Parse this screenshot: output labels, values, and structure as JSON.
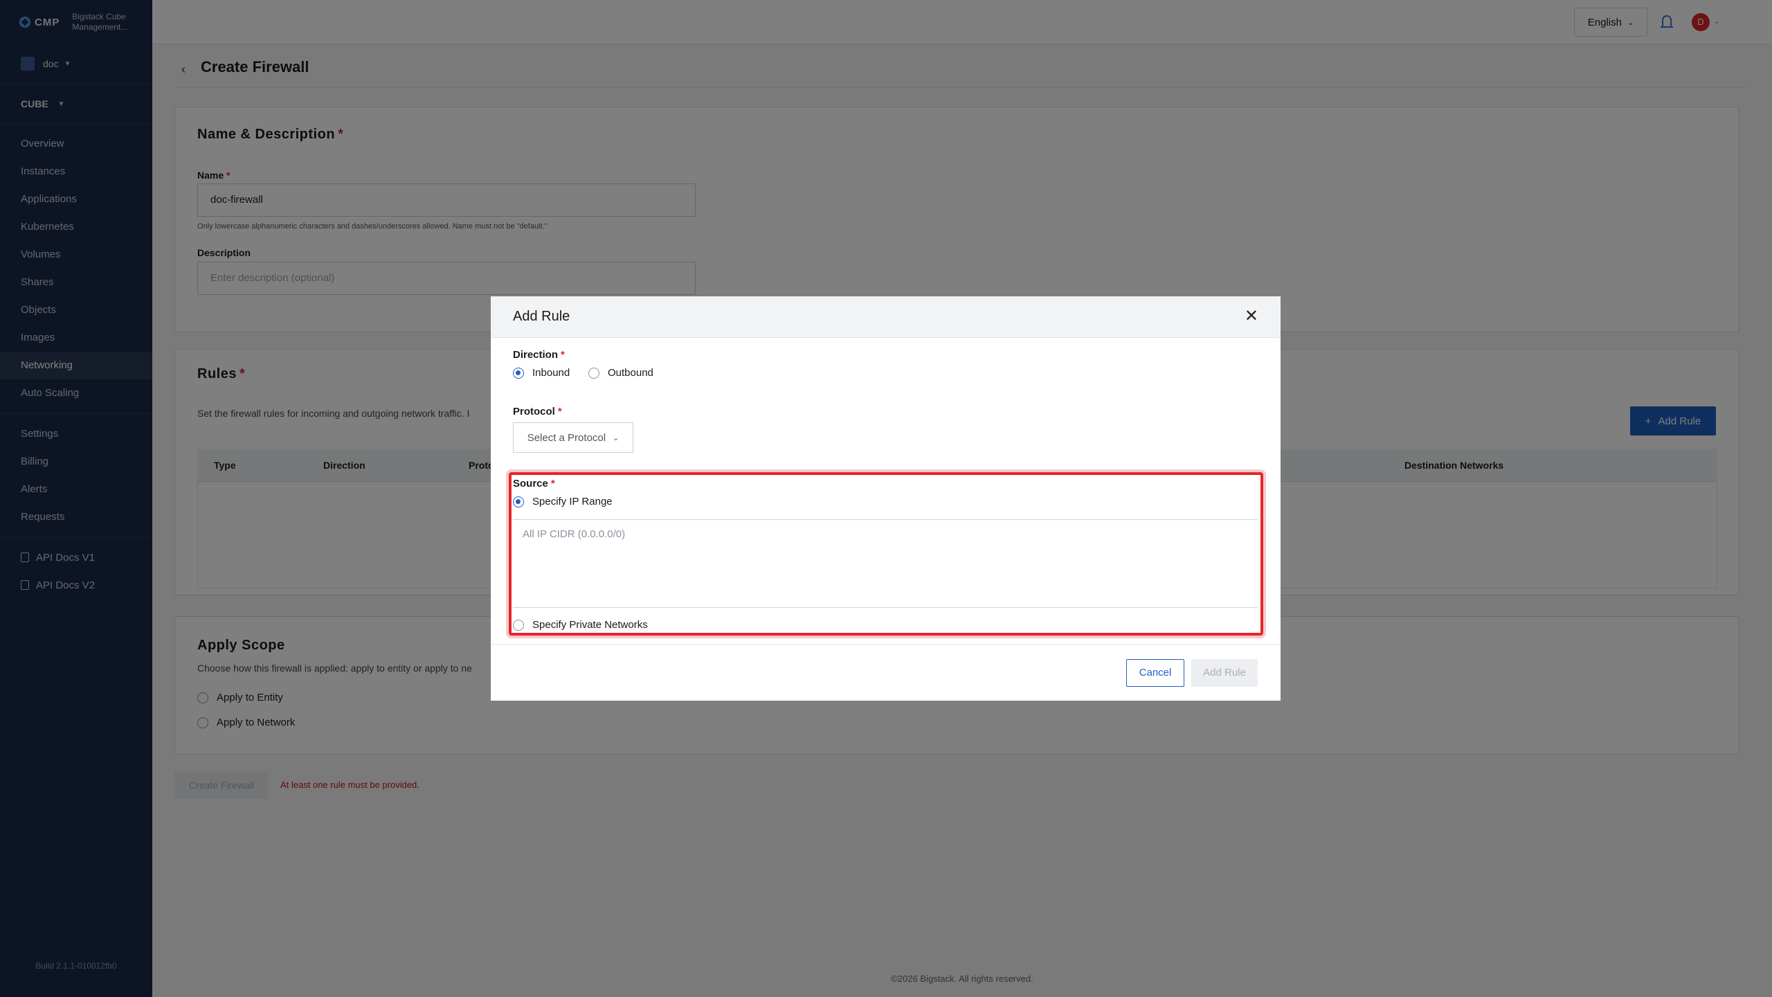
{
  "brand": {
    "short": "CMP",
    "name_line1": "Bigstack Cube",
    "name_line2": "Management..."
  },
  "sidebar": {
    "org": "doc",
    "project": "CUBE",
    "items": [
      {
        "label": "Overview"
      },
      {
        "label": "Instances"
      },
      {
        "label": "Applications"
      },
      {
        "label": "Kubernetes"
      },
      {
        "label": "Volumes"
      },
      {
        "label": "Shares"
      },
      {
        "label": "Objects"
      },
      {
        "label": "Images"
      },
      {
        "label": "Networking"
      },
      {
        "label": "Auto Scaling"
      },
      {
        "label": "Settings"
      },
      {
        "label": "Billing"
      },
      {
        "label": "Alerts"
      },
      {
        "label": "Requests"
      }
    ],
    "docs": [
      {
        "label": "API Docs V1"
      },
      {
        "label": "API Docs V2"
      }
    ],
    "build": "Build 2.1.1-010012fb0"
  },
  "topbar": {
    "language": "English",
    "avatar_initial": "D"
  },
  "page": {
    "title": "Create Firewall",
    "name_section": {
      "title": "Name & Description",
      "name_label": "Name",
      "name_value": "doc-firewall",
      "name_hint": "Only lowercase alphanumeric characters and dashes/underscores allowed. Name must not be \"default.\"",
      "description_label": "Description",
      "description_placeholder": "Enter description (optional)"
    },
    "rules_section": {
      "title": "Rules",
      "description": "Set the firewall rules for incoming and outgoing network traffic. I",
      "add_rule_label": "Add Rule",
      "columns": [
        "Type",
        "Direction",
        "Proto",
        "Destination Networks"
      ]
    },
    "scope_section": {
      "title": "Apply Scope",
      "description": "Choose how this firewall is applied: apply to entity or apply to ne",
      "options": [
        "Apply to Entity",
        "Apply to Network"
      ]
    },
    "create_button": "Create Firewall",
    "error": "At least one rule must be provided.",
    "footer": "©2026 Bigstack. All rights reserved."
  },
  "modal": {
    "title": "Add Rule",
    "direction_label": "Direction",
    "direction_options": [
      "Inbound",
      "Outbound"
    ],
    "protocol_label": "Protocol",
    "protocol_placeholder": "Select a Protocol",
    "source_label": "Source",
    "source_options": [
      "Specify IP Range",
      "Specify Private Networks"
    ],
    "cidr_placeholder": "All IP CIDR (0.0.0.0/0)",
    "cancel_label": "Cancel",
    "add_rule_label": "Add Rule"
  },
  "colors": {
    "sidebar": "#1b2a4a",
    "primary": "#1f5fbf",
    "danger": "#d9262c"
  }
}
